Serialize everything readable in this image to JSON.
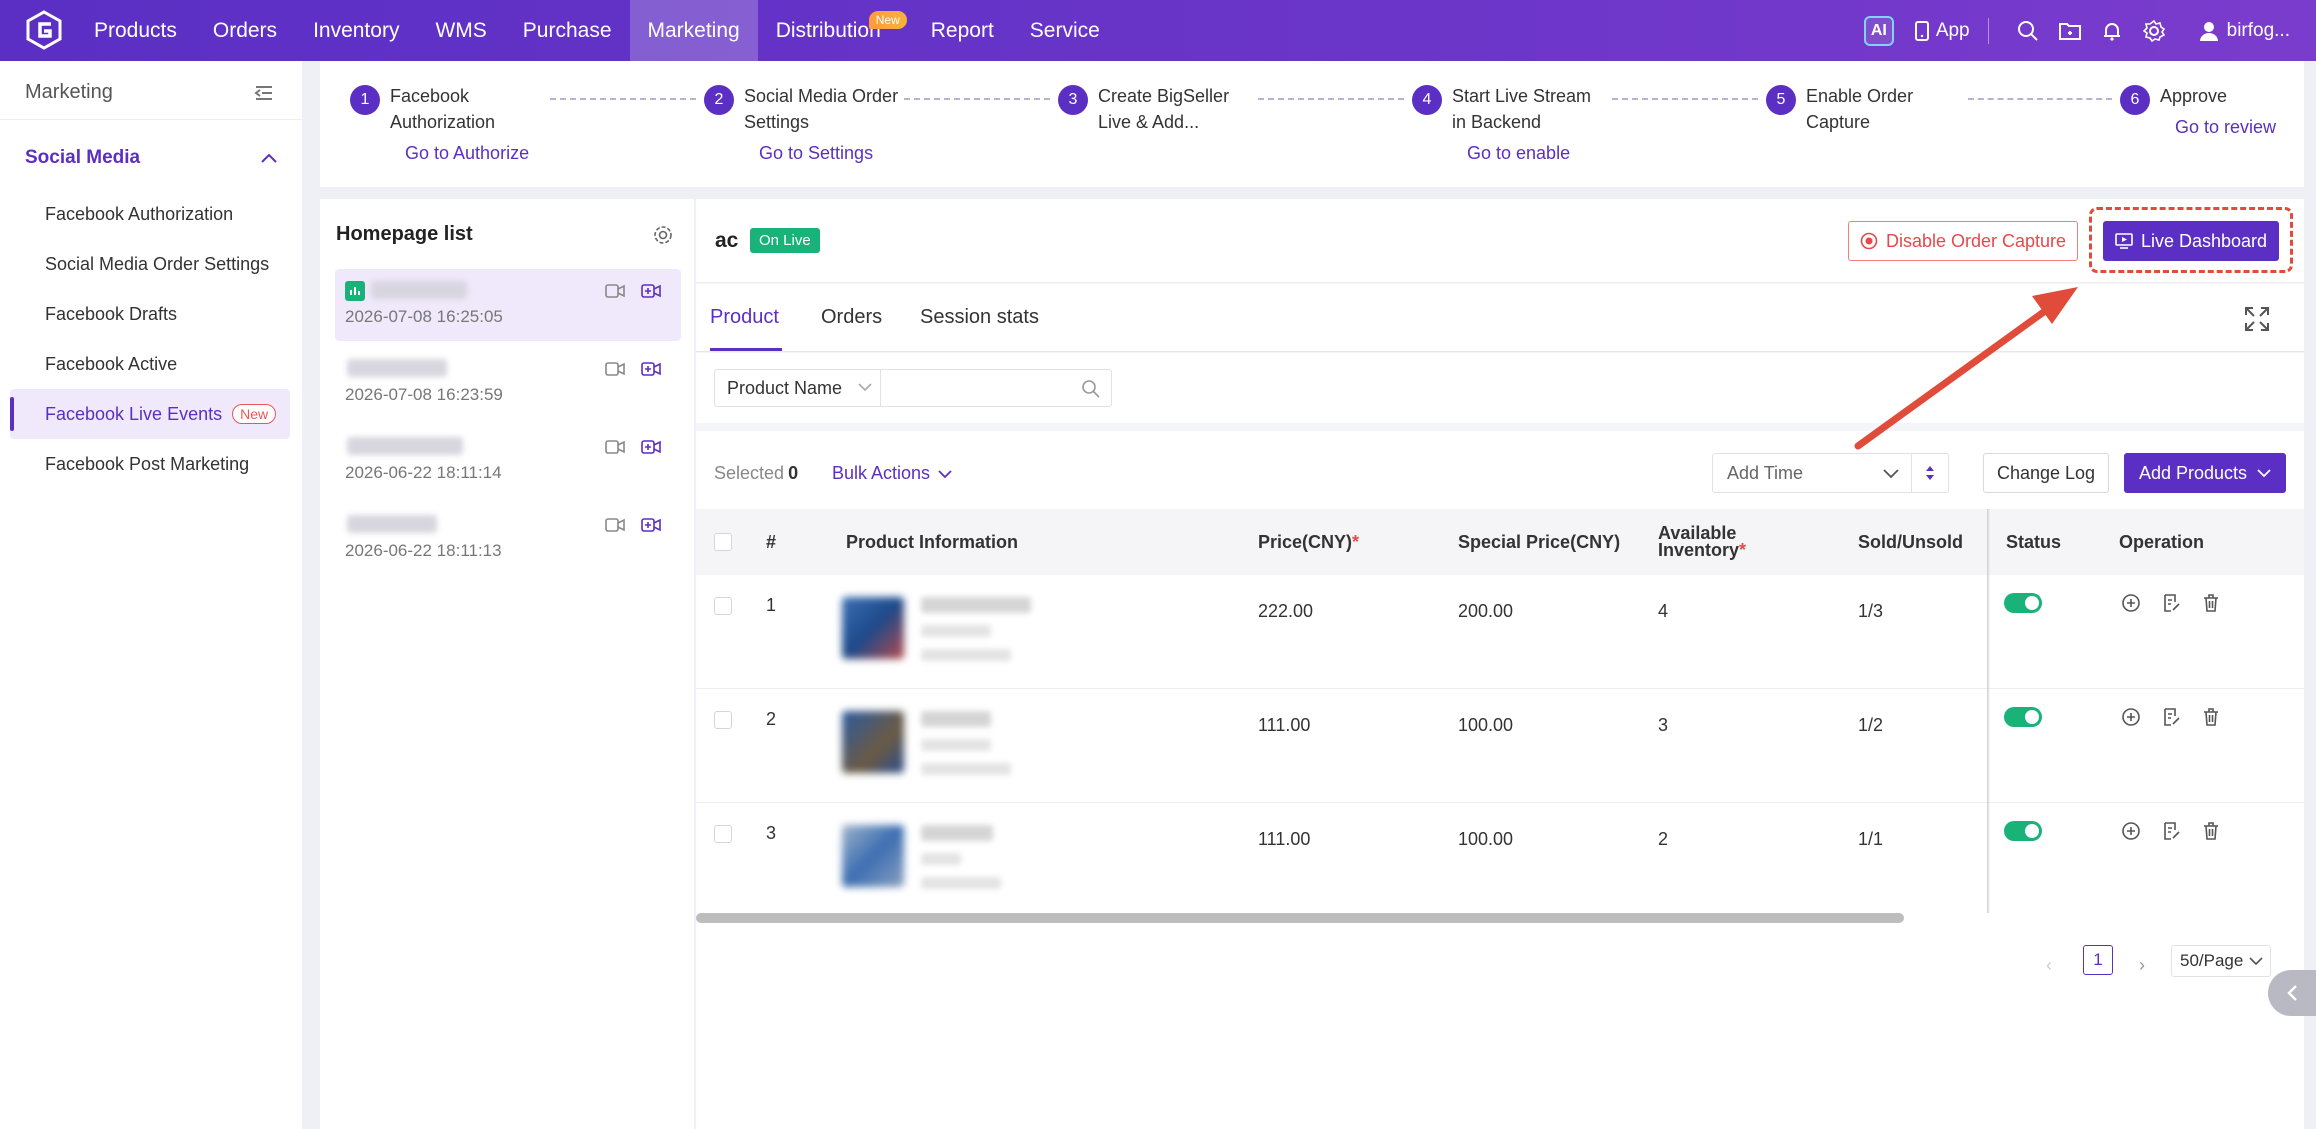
{
  "topnav": {
    "items": [
      "Products",
      "Orders",
      "Inventory",
      "WMS",
      "Purchase",
      "Marketing",
      "Distribution",
      "Report",
      "Service"
    ],
    "active": "Marketing",
    "distribution_badge": "New",
    "ai_label": "AI",
    "app_label": "App",
    "user": "birfog..."
  },
  "sidebar": {
    "title": "Marketing",
    "group": "Social Media",
    "items": [
      {
        "label": "Facebook Authorization"
      },
      {
        "label": "Social Media Order Settings"
      },
      {
        "label": "Facebook Drafts"
      },
      {
        "label": "Facebook Active"
      },
      {
        "label": "Facebook Live Events",
        "badge": "New"
      },
      {
        "label": "Facebook Post Marketing"
      }
    ],
    "active": "Facebook Live Events"
  },
  "steps": [
    {
      "num": "1",
      "label": "Facebook Authorization",
      "link": "Go to Authorize"
    },
    {
      "num": "2",
      "label": "Social Media Order Settings",
      "link": "Go to Settings"
    },
    {
      "num": "3",
      "label": "Create BigSeller Live & Add...",
      "link": ""
    },
    {
      "num": "4",
      "label": "Start Live Stream in Backend",
      "link": "Go to enable"
    },
    {
      "num": "5",
      "label": "Enable Order Capture",
      "link": ""
    },
    {
      "num": "6",
      "label": "Approve",
      "link": "Go to review"
    }
  ],
  "homepage": {
    "title": "Homepage list",
    "items": [
      {
        "time": "2026-07-08 16:25:05",
        "live": true
      },
      {
        "time": "2026-07-08 16:23:59",
        "live": false
      },
      {
        "time": "2026-06-22 18:11:14",
        "live": false
      },
      {
        "time": "2026-06-22 18:11:13",
        "live": false
      }
    ]
  },
  "session": {
    "name": "ac",
    "status": "On Live",
    "disable_label": "Disable Order Capture",
    "dashboard_label": "Live Dashboard"
  },
  "tabs": [
    "Product",
    "Orders",
    "Session stats"
  ],
  "active_tab": "Product",
  "filter": {
    "field": "Product Name",
    "value": ""
  },
  "toolbar": {
    "selected_label": "Selected",
    "selected_count": "0",
    "bulk_label": "Bulk Actions",
    "sort_label": "Add Time",
    "changelog_label": "Change Log",
    "add_label": "Add Products"
  },
  "table": {
    "headers": {
      "num": "#",
      "info": "Product Information",
      "price": "Price(CNY)",
      "special": "Special Price(CNY)",
      "inv_line1": "Available",
      "inv_line2": "Inventory",
      "sold": "Sold/Unsold",
      "status": "Status",
      "operation": "Operation"
    },
    "rows": [
      {
        "num": "1",
        "price": "222.00",
        "special": "200.00",
        "inventory": "4",
        "sold": "1/3",
        "enabled": true
      },
      {
        "num": "2",
        "price": "111.00",
        "special": "100.00",
        "inventory": "3",
        "sold": "1/2",
        "enabled": true
      },
      {
        "num": "3",
        "price": "111.00",
        "special": "100.00",
        "inventory": "2",
        "sold": "1/1",
        "enabled": true
      }
    ]
  },
  "pagination": {
    "current": "1",
    "page_size": "50/Page"
  },
  "colors": {
    "brand": "#5b2fc4",
    "live": "#19b37a",
    "danger": "#e5494a",
    "annotation": "#e14b3a"
  }
}
